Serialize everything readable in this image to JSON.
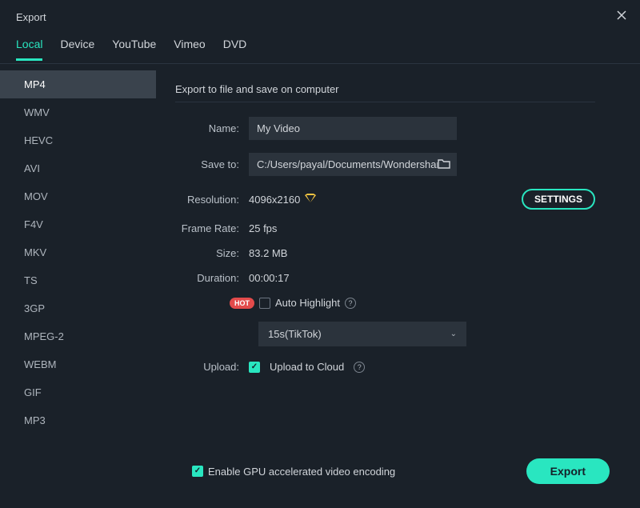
{
  "window": {
    "title": "Export"
  },
  "tabs": [
    "Local",
    "Device",
    "YouTube",
    "Vimeo",
    "DVD"
  ],
  "active_tab": "Local",
  "formats": [
    "MP4",
    "WMV",
    "HEVC",
    "AVI",
    "MOV",
    "F4V",
    "MKV",
    "TS",
    "3GP",
    "MPEG-2",
    "WEBM",
    "GIF",
    "MP3"
  ],
  "selected_format": "MP4",
  "section_title": "Export to file and save on computer",
  "labels": {
    "name": "Name:",
    "save_to": "Save to:",
    "resolution": "Resolution:",
    "frame_rate": "Frame Rate:",
    "size": "Size:",
    "duration": "Duration:",
    "upload": "Upload:"
  },
  "fields": {
    "name_value": "My Video",
    "save_path": "C:/Users/payal/Documents/Wondershare,",
    "resolution_value": "4096x2160",
    "frame_rate_value": "25 fps",
    "size_value": "83.2 MB",
    "duration_value": "00:00:17",
    "auto_highlight_label": "Auto Highlight",
    "highlight_preset_selected": "15s(TikTok)",
    "upload_label": "Upload to Cloud"
  },
  "buttons": {
    "settings": "SETTINGS",
    "export": "Export"
  },
  "badges": {
    "hot": "HOT"
  },
  "gpu_label": "Enable GPU accelerated video encoding",
  "checks": {
    "auto_highlight": false,
    "upload_cloud": true,
    "gpu": true
  },
  "colors": {
    "accent": "#29e6c0",
    "bg": "#1a2129",
    "input_bg": "#2b333c",
    "hot": "#e34b4b",
    "premium": "#f5c542"
  }
}
